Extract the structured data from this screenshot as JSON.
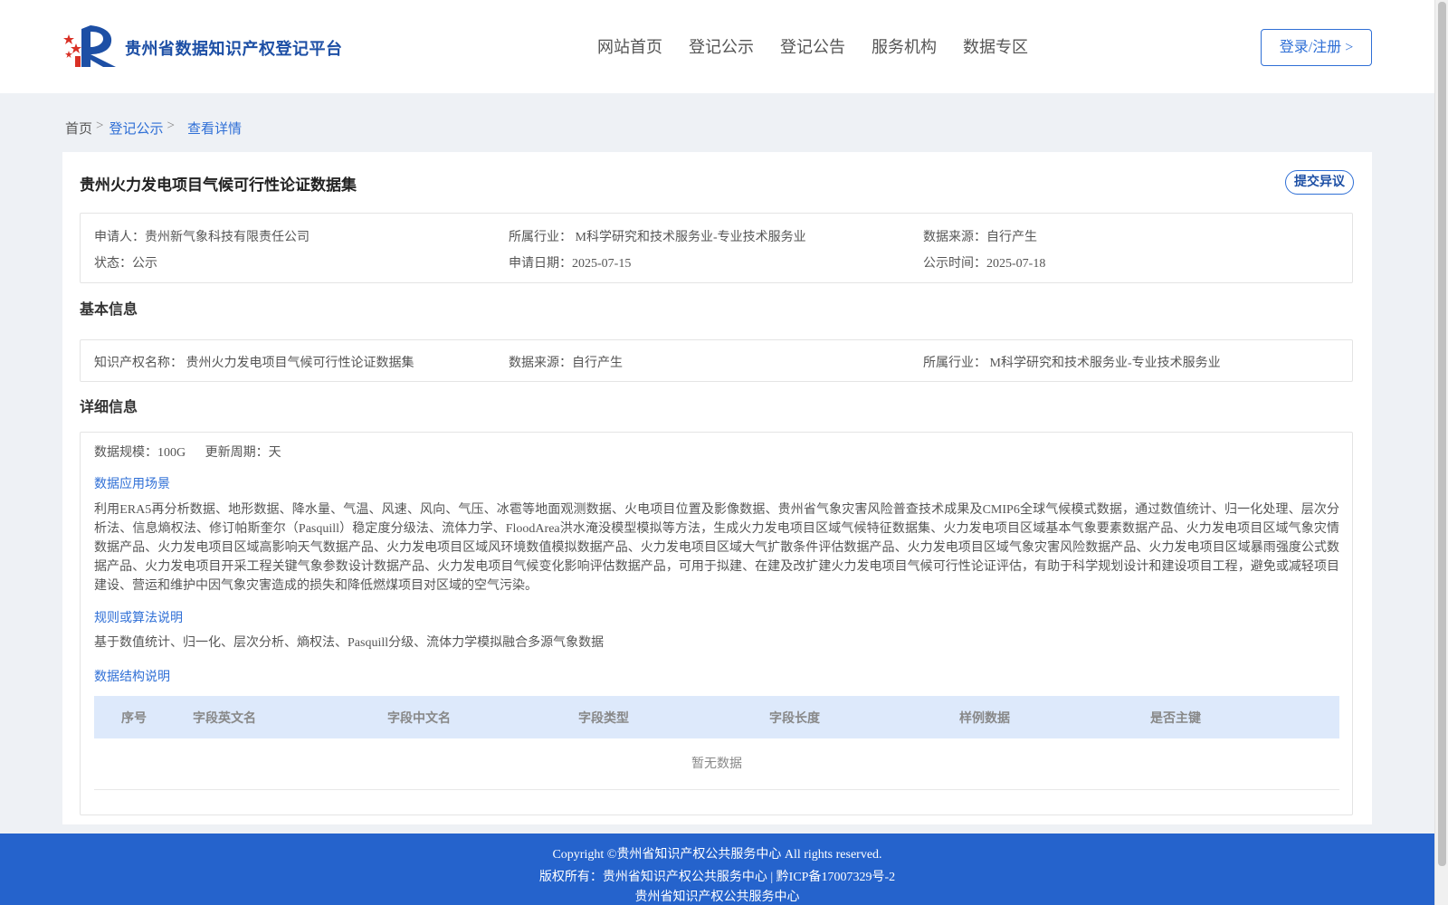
{
  "header": {
    "site_title": "贵州省数据知识产权登记平台",
    "logo": "ip-registration-logo",
    "nav": [
      "网站首页",
      "登记公示",
      "登记公告",
      "服务机构",
      "数据专区"
    ],
    "login_label": "登录/注册 >"
  },
  "breadcrumb": {
    "home": "首页",
    "sep": ">",
    "publicity": "登记公示",
    "current": "查看详情"
  },
  "dataset": {
    "title": "贵州火力发电项目气候可行性论证数据集",
    "objection_label": "提交异议",
    "meta": {
      "applicant": "申请人：贵州新气象科技有限责任公司",
      "industry": "所属行业： M科学研究和技术服务业-专业技术服务业",
      "source": "数据来源：自行产生",
      "status": "状态：公示",
      "apply_date": "申请日期：2025-07-15",
      "publicity_date": "公示时间：2025-07-18"
    }
  },
  "basic": {
    "title": "基本信息",
    "ip_name": "知识产权名称： 贵州火力发电项目气候可行性论证数据集",
    "source": "数据来源：自行产生",
    "industry": "所属行业： M科学研究和技术服务业-专业技术服务业"
  },
  "detail": {
    "title": "详细信息",
    "scale": "数据规模：100G",
    "cycle": "更新周期：天",
    "scenario_title": "数据应用场景",
    "scenario_text": "利用ERA5再分析数据、地形数据、降水量、气温、风速、风向、气压、冰雹等地面观测数据、火电项目位置及影像数据、贵州省气象灾害风险普查技术成果及CMIP6全球气候模式数据，通过数值统计、归一化处理、层次分析法、信息熵权法、修订帕斯奎尔（Pasquill）稳定度分级法、流体力学、FloodArea洪水淹没模型模拟等方法，生成火力发电项目区域气候特征数据集、火力发电项目区域基本气象要素数据产品、火力发电项目区域气象灾情数据产品、火力发电项目区域高影响天气数据产品、火力发电项目区域风环境数值模拟数据产品、火力发电项目区域大气扩散条件评估数据产品、火力发电项目区域气象灾害风险数据产品、火力发电项目区域暴雨强度公式数据产品、火力发电项目开采工程关键气象参数设计数据产品、火力发电项目气候变化影响评估数据产品，可用于拟建、在建及改扩建火力发电项目气候可行性论证评估，有助于科学规划设计和建设项目工程，避免或减轻项目建设、营运和维护中因气象灾害造成的损失和降低燃煤项目对区域的空气污染。",
    "algorithm_title": "规则或算法说明",
    "algorithm_text": "基于数值统计、归一化、层次分析、熵权法、Pasquill分级、流体力学模拟融合多源气象数据",
    "structure_title": "数据结构说明",
    "table_columns": [
      "序号",
      "字段英文名",
      "字段中文名",
      "字段类型",
      "字段长度",
      "样例数据",
      "是否主键"
    ],
    "empty_text": "暂无数据"
  },
  "footer": {
    "copyright": "Copyright ©贵州省知识产权公共服务中心 All rights reserved.",
    "owner": "版权所有：贵州省知识产权公共服务中心 | 黔ICP备17007329号-2",
    "org": "贵州省知识产权公共服务中心"
  },
  "colors": {
    "brand_blue": "#2f6fd6",
    "title_blue": "#1d4fa5",
    "footer_blue": "#2563cc",
    "table_head_bg": "#dde9fb",
    "page_bg": "#eef1f5",
    "logo_red": "#d93025"
  }
}
